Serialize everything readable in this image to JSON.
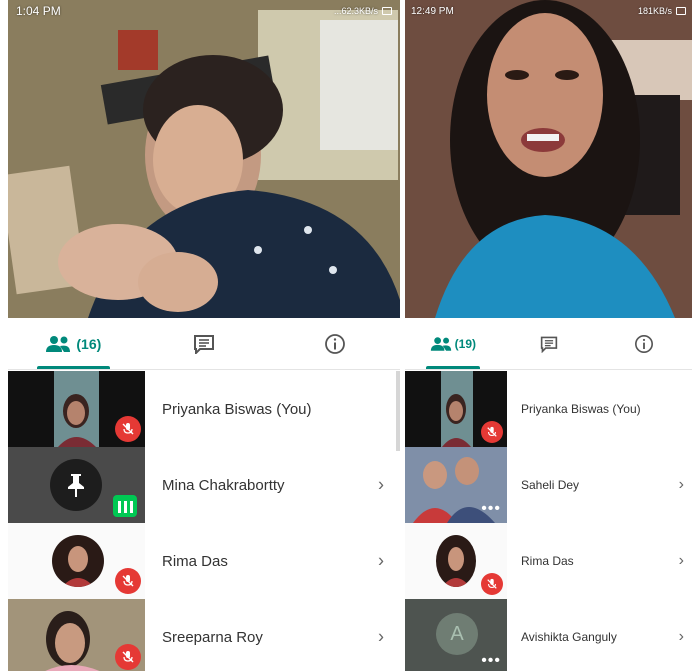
{
  "left": {
    "status_time": "1:04 PM",
    "status_right": "...62.3KB/s",
    "participants_count": "(16)",
    "participants": [
      {
        "name": "Priyanka Biswas (You)",
        "mic": "muted",
        "has_chevron": false
      },
      {
        "name": "Mina Chakrabortty",
        "mic": "speaking",
        "has_chevron": true
      },
      {
        "name": "Rima Das",
        "mic": "muted",
        "has_chevron": true
      },
      {
        "name": "Sreeparna Roy",
        "mic": "muted",
        "has_chevron": true
      }
    ]
  },
  "right": {
    "status_time": "12:49 PM",
    "status_right": "181KB/s",
    "participants_count": "(19)",
    "participants": [
      {
        "name": "Priyanka Biswas (You)",
        "mic": "muted",
        "has_chevron": false
      },
      {
        "name": "Saheli Dey",
        "mic": "dots",
        "has_chevron": true
      },
      {
        "name": "Rima Das",
        "mic": "muted",
        "has_chevron": true
      },
      {
        "name": "Avishikta Ganguly",
        "mic": "dots",
        "has_chevron": true,
        "avatar_letter": "A"
      }
    ]
  },
  "tabs": [
    "participants",
    "chat",
    "info"
  ],
  "chevron": "›",
  "colors": {
    "accent": "#00897b",
    "mic_off": "#e53935",
    "speaking": "#00c853"
  }
}
